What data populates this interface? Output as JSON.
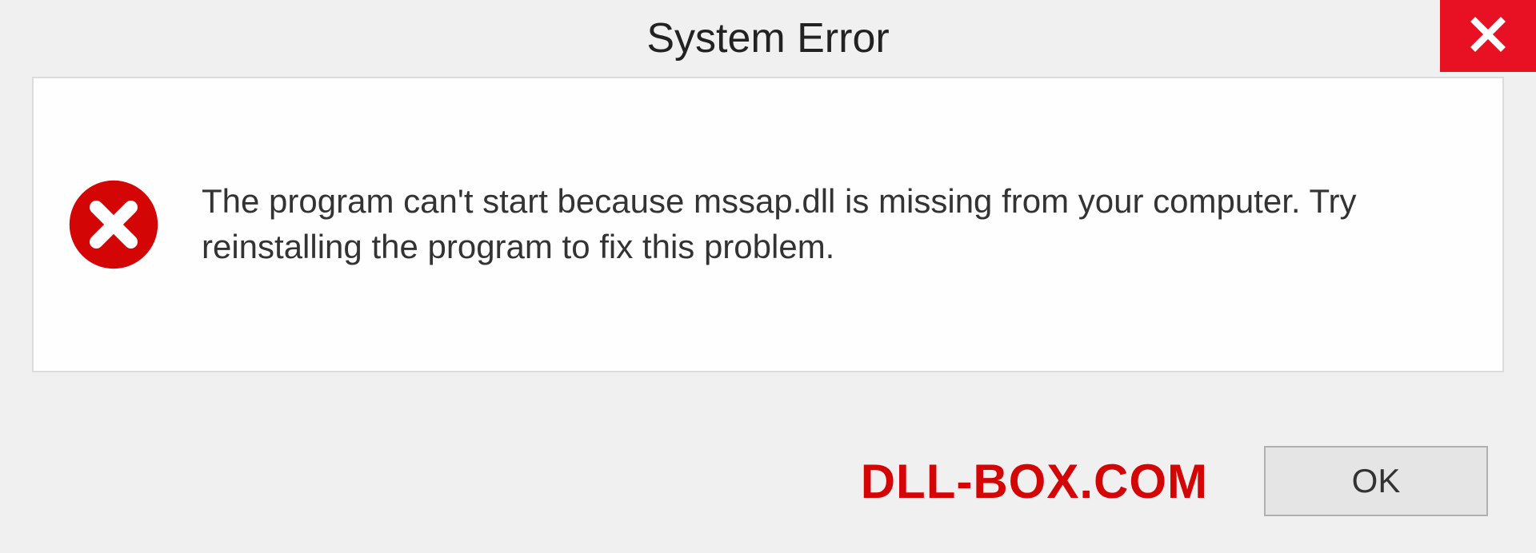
{
  "dialog": {
    "title": "System Error",
    "message": "The program can't start because mssap.dll is missing from your computer. Try reinstalling the program to fix this problem.",
    "ok_label": "OK"
  },
  "watermark": "DLL-BOX.COM",
  "colors": {
    "close_button_bg": "#e81123",
    "error_icon_fill": "#d30505",
    "watermark_color": "#d30505"
  }
}
